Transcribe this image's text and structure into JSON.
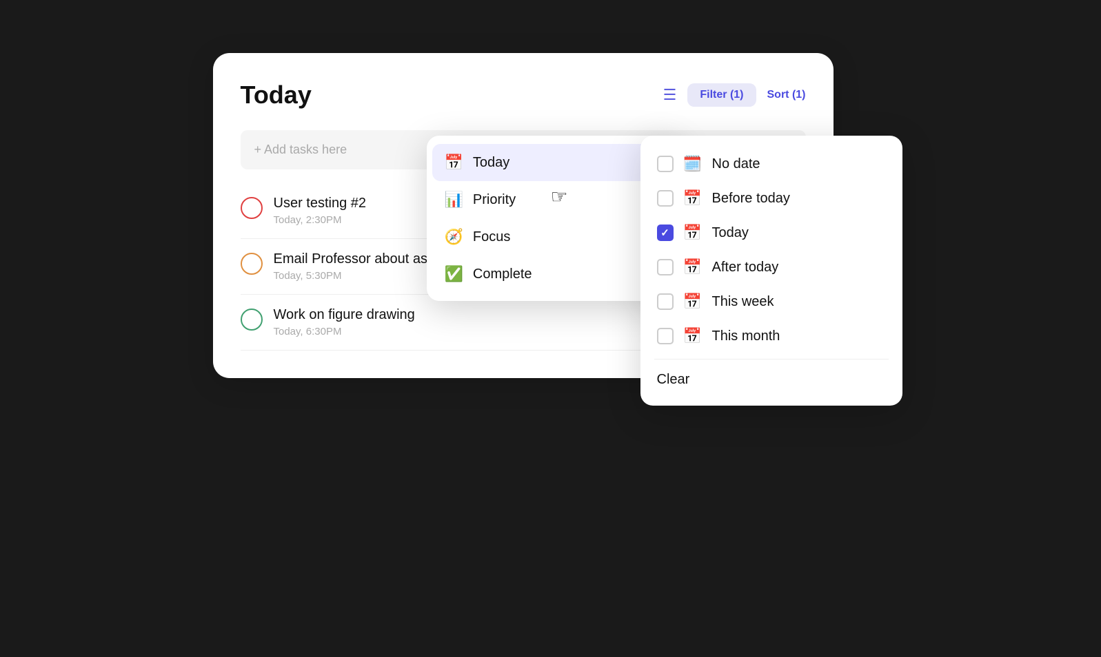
{
  "page": {
    "title": "Today"
  },
  "header": {
    "filter_label": "Filter (1)",
    "sort_label": "Sort (1)"
  },
  "add_task": {
    "placeholder": "+ Add tasks here"
  },
  "tasks": [
    {
      "id": 1,
      "name": "User testing #2",
      "time": "Today, 2:30PM",
      "color": "red"
    },
    {
      "id": 2,
      "name": "Email Professor about assignment",
      "time": "Today, 5:30PM",
      "color": "orange"
    },
    {
      "id": 3,
      "name": "Work on figure drawing",
      "time": "Today, 6:30PM",
      "color": "green"
    }
  ],
  "filter_menu": {
    "items": [
      {
        "id": "today",
        "label": "Today",
        "icon": "📅",
        "active": true
      },
      {
        "id": "priority",
        "label": "Priority",
        "icon": "📊",
        "active": false
      },
      {
        "id": "focus",
        "label": "Focus",
        "icon": "🧭",
        "active": false
      },
      {
        "id": "complete",
        "label": "Complete",
        "icon": "✅",
        "active": false
      }
    ]
  },
  "date_submenu": {
    "options": [
      {
        "id": "no-date",
        "label": "No date",
        "checked": false
      },
      {
        "id": "before-today",
        "label": "Before today",
        "checked": false
      },
      {
        "id": "today",
        "label": "Today",
        "checked": true
      },
      {
        "id": "after-today",
        "label": "After today",
        "checked": false
      },
      {
        "id": "this-week",
        "label": "This week",
        "checked": false
      },
      {
        "id": "this-month",
        "label": "This month",
        "checked": false
      }
    ],
    "clear_label": "Clear"
  }
}
